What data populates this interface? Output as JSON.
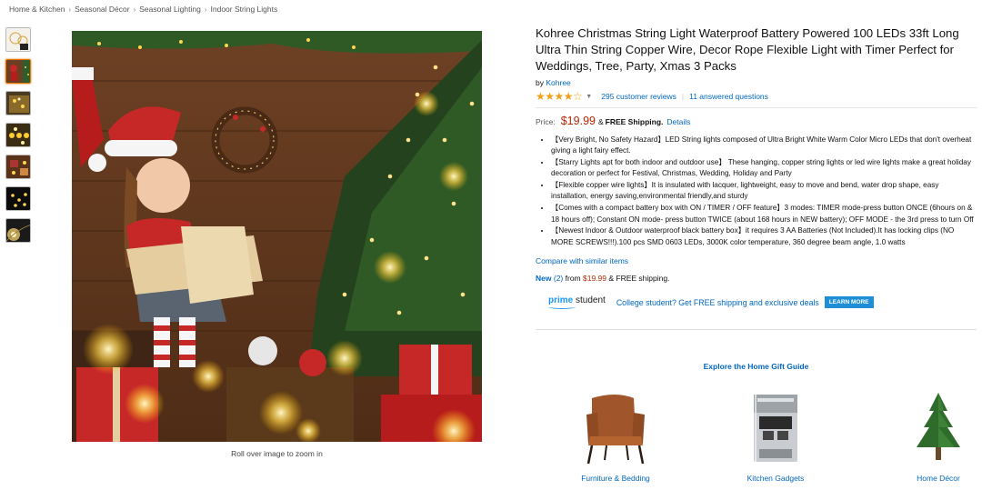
{
  "breadcrumb": [
    "Home & Kitchen",
    "Seasonal Décor",
    "Seasonal Lighting",
    "Indoor String Lights"
  ],
  "breadcrumb_separator": "›",
  "product": {
    "title": "Kohree Christmas String Light Waterproof Battery Powered 100 LEDs 33ft Long Ultra Thin String Copper Wire, Decor Rope Flexible Light with Timer Perfect for Weddings, Tree, Party, Xmas 3 Packs",
    "by_label": "by",
    "brand": "Kohree",
    "rating": 3.5,
    "stars_text": "★★★★☆",
    "reviews_link": "295 customer reviews",
    "questions_link": "11 answered questions",
    "price_label": "Price:",
    "price": "$19.99",
    "price_amp": "&",
    "shipping": "FREE Shipping.",
    "details_link": "Details",
    "bullets": [
      "【Very Bright, No Safety Hazard】LED String lights composed of Ultra Bright White Warm Color Micro LEDs that don't overheat giving a light fairy effect.",
      "【Starry Lights apt for both indoor and outdoor use】 These hanging, copper string lights or led wire lights make a great holiday decoration or perfect for Festival, Christmas, Wedding, Holiday and Party",
      "【Flexible copper wire lights】It is insulated with lacquer, lightweight, easy to move and bend, water drop shape, easy installation, energy saving,environmental friendly,and sturdy",
      "【Comes with a compact battery box with ON / TIMER / OFF feature】3 modes: TIMER mode-press button ONCE (6hours on & 18 hours off); Constant ON mode- press button TWICE (about 168 hours in NEW battery); OFF MODE - the 3rd press to turn Off",
      "【Newest Indoor & Outdoor waterproof black battery box】it requires 3 AA Batteries (Not Included).It has locking clips (NO MORE SCREWS!!!).100 pcs SMD 0603 LEDs, 3000K color temperature, 360 degree beam angle, 1.0 watts"
    ],
    "compare_link": "Compare with similar items",
    "new_label": "New",
    "new_count": "(2)",
    "new_from": "from",
    "new_price": "$19.99",
    "new_shipping": "& FREE shipping."
  },
  "prime": {
    "logo_prime": "prime",
    "logo_student": "student",
    "text": "College student? Get FREE shipping and exclusive deals",
    "button": "LEARN MORE"
  },
  "gift_guide": {
    "title": "Explore the Home Gift Guide",
    "items": [
      {
        "label": "Furniture & Bedding"
      },
      {
        "label": "Kitchen Gadgets"
      },
      {
        "label": "Home Décor"
      }
    ]
  },
  "zoom_hint": "Roll over image to zoom in",
  "colors": {
    "link": "#0066c0",
    "price": "#b12704",
    "star": "#f0a11a",
    "thumb_active": "#e77600",
    "prime_blue": "#1a98ff"
  }
}
